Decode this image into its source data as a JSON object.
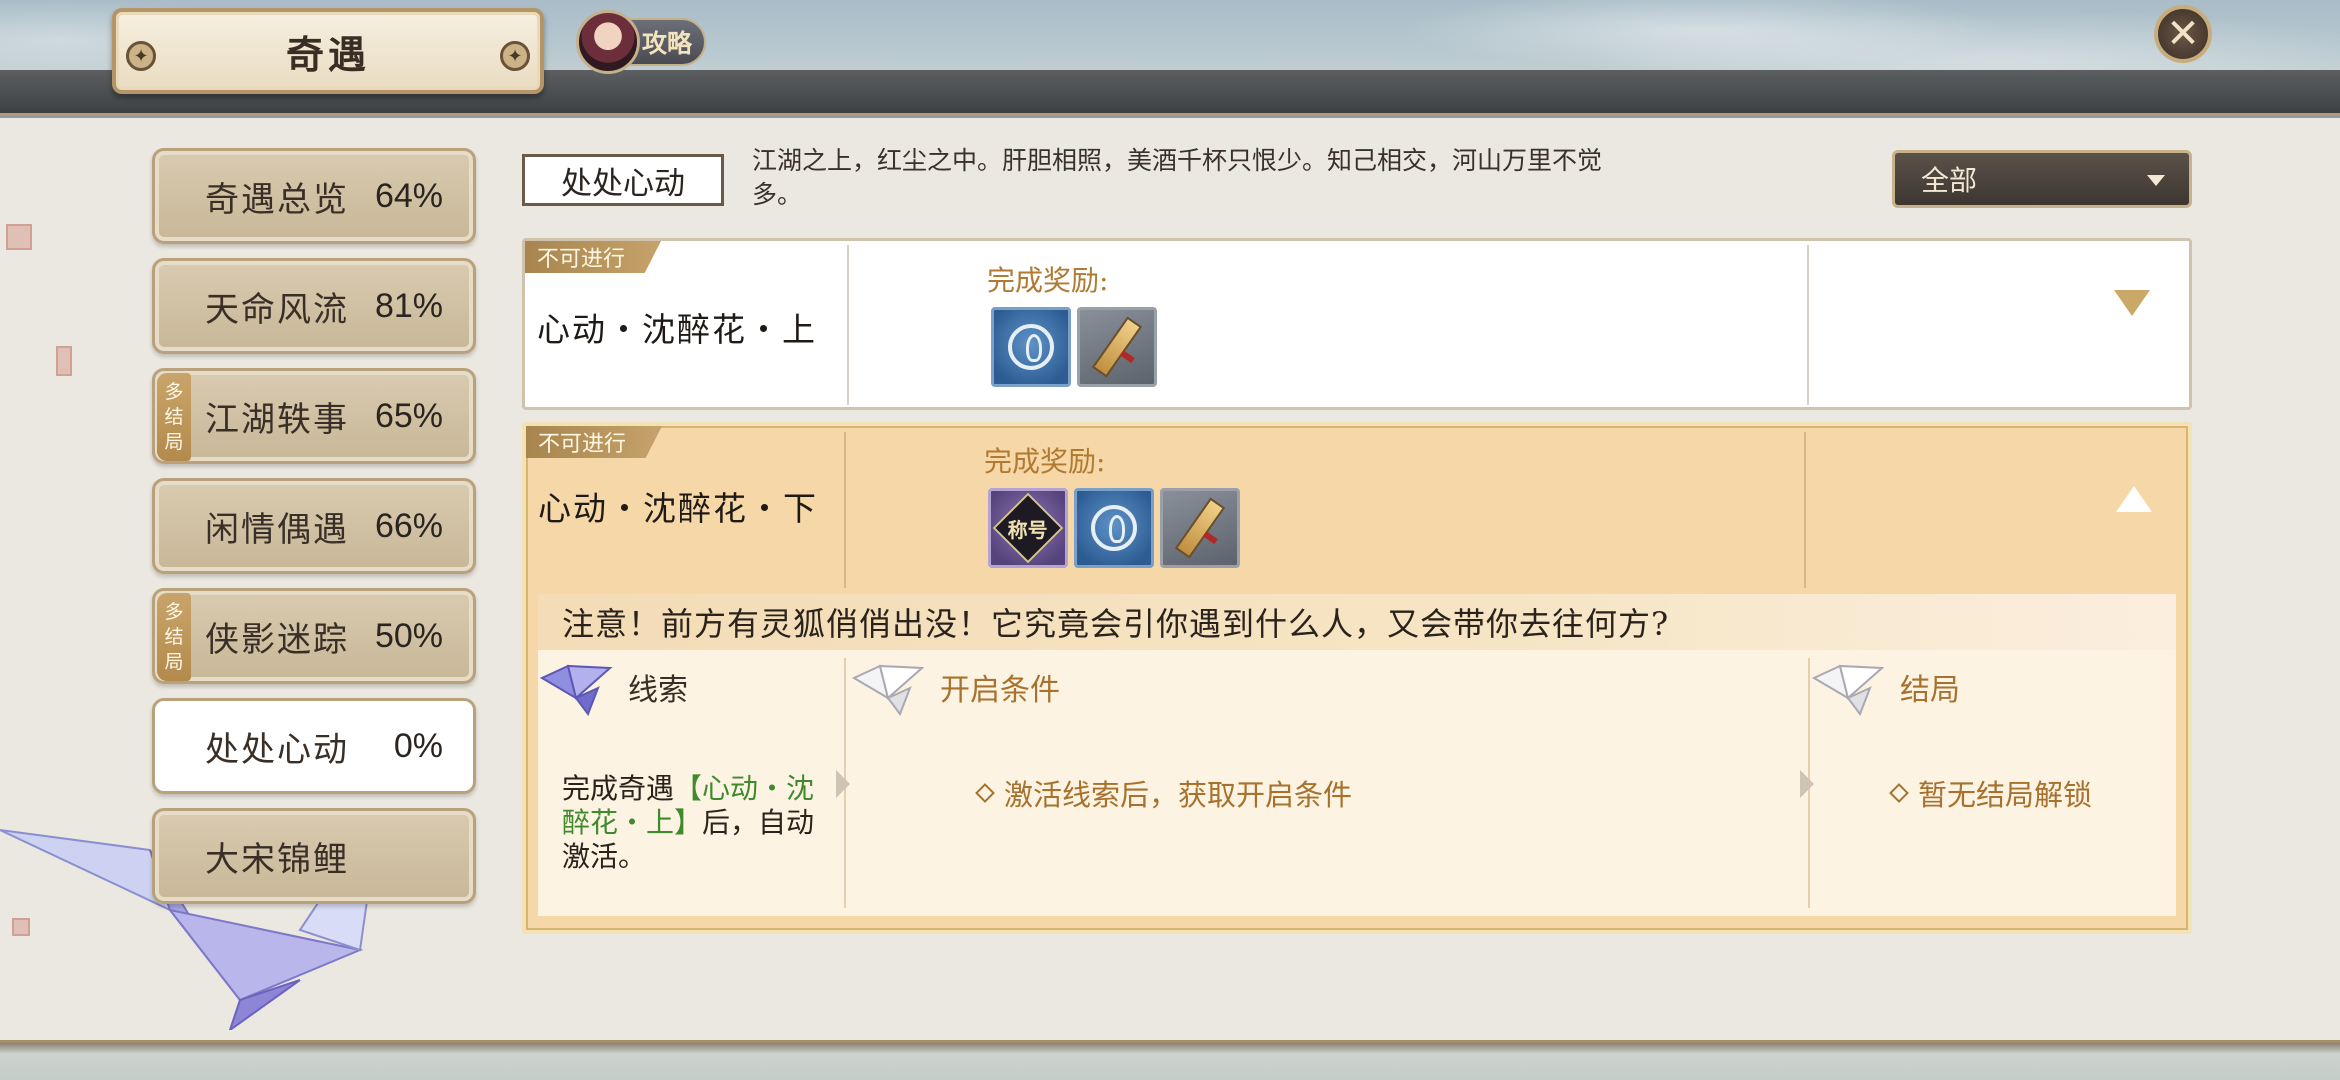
{
  "header": {
    "title": "奇遇",
    "guide_label": "攻略",
    "close_glyph": "✕"
  },
  "sidebar": {
    "items": [
      {
        "label": "奇遇总览",
        "pct": "64%",
        "multi": false
      },
      {
        "label": "天命风流",
        "pct": "81%",
        "multi": false
      },
      {
        "label": "江湖轶事",
        "pct": "65%",
        "multi": true
      },
      {
        "label": "闲情偶遇",
        "pct": "66%",
        "multi": false
      },
      {
        "label": "侠影迷踪",
        "pct": "50%",
        "multi": true
      },
      {
        "label": "处处心动",
        "pct": "0%",
        "multi": false,
        "active": true
      },
      {
        "label": "大宋锦鲤",
        "pct": "",
        "multi": false
      }
    ],
    "multi_badge": [
      "多",
      "结",
      "局"
    ]
  },
  "main": {
    "section_title": "处处心动",
    "section_desc": "江湖之上，红尘之中。肝胆相照，美酒千杯只恨少。知己相交，河山万里不觉多。",
    "filter": {
      "selected": "全部"
    },
    "cards": [
      {
        "status": "不可进行",
        "name": "心动・沈醉花・上",
        "reward_label": "完成奖励:",
        "rewards": [
          "ring-token",
          "scroll-token"
        ],
        "expanded": false
      },
      {
        "status": "不可进行",
        "name": "心动・沈醉花・下",
        "reward_label": "完成奖励:",
        "rewards": [
          "title-token",
          "ring-token",
          "scroll-token"
        ],
        "title_token_text": "称号",
        "expanded": true,
        "notice": "注意！前方有灵狐俏俏出没！它究竟会引你遇到什么人，又会带你去往何方?",
        "columns": {
          "clue": "线索",
          "condition": "开启条件",
          "ending": "结局"
        },
        "clue_text_pre": "完成奇遇",
        "clue_text_hl": "【心动・沈醉花・上】",
        "clue_text_post": "后，自动激活。",
        "condition_text": "激活线索后，获取开启条件",
        "ending_text": "暂无结局解锁"
      }
    ]
  },
  "colors": {
    "accent_gold": "#a6722e",
    "highlight_green": "#3f8a2c",
    "expanded_card_bg": "#f5d7a8"
  }
}
